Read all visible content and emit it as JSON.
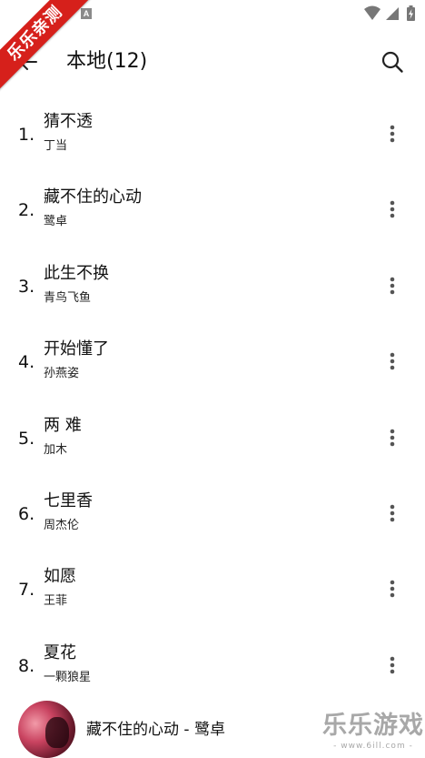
{
  "status_bar": {
    "notification_badge": "A",
    "icons": [
      "wifi-icon",
      "signal-icon",
      "battery-charging-icon"
    ]
  },
  "watermark": {
    "ribbon_text": "乐乐亲测",
    "ribbon_color": "#d6201b",
    "logo_text": "乐乐游戏",
    "logo_url": "- www.6ill.com -"
  },
  "header": {
    "title": "本地(12)"
  },
  "songs": [
    {
      "index": "1.",
      "title": "猜不透",
      "artist": "丁当"
    },
    {
      "index": "2.",
      "title": "藏不住的心动",
      "artist": "鹭卓"
    },
    {
      "index": "3.",
      "title": "此生不换",
      "artist": "青鸟飞鱼"
    },
    {
      "index": "4.",
      "title": "开始懂了",
      "artist": "孙燕姿"
    },
    {
      "index": "5.",
      "title": "两 难",
      "artist": "加木"
    },
    {
      "index": "6.",
      "title": "七里香",
      "artist": "周杰伦"
    },
    {
      "index": "7.",
      "title": "如愿",
      "artist": "王菲"
    },
    {
      "index": "8.",
      "title": "夏花",
      "artist": "一颗狼星"
    }
  ],
  "player": {
    "now_playing": "藏不住的心动 - 鹭卓"
  }
}
